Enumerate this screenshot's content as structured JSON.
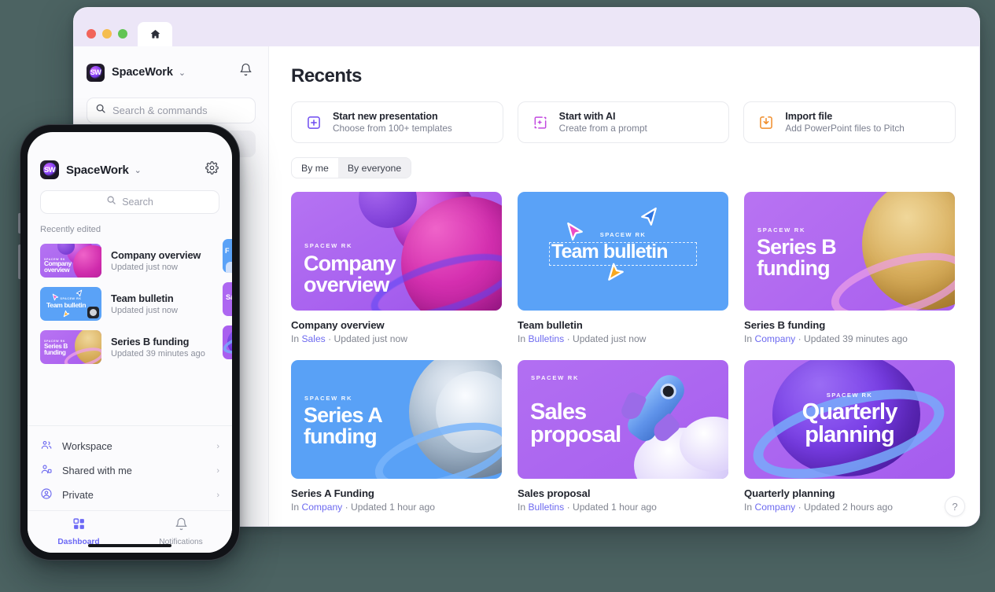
{
  "desktop": {
    "titlebar": {
      "tab_icon": "home-icon",
      "traffic_lights": [
        "close",
        "minimize",
        "maximize"
      ]
    },
    "sidebar": {
      "workspace_name": "SpaceWork",
      "workspace_logo_text": "SW",
      "chevron": "⌄",
      "notification_icon": "bell-icon",
      "search": {
        "placeholder": "Search & commands",
        "icon": "search-icon"
      }
    },
    "main": {
      "page_title": "Recents",
      "actions": [
        {
          "icon": "plus-square-icon",
          "title": "Start new presentation",
          "subtitle": "Choose from 100+ templates"
        },
        {
          "icon": "sparkle-ai-icon",
          "title": "Start with AI",
          "subtitle": "Create from a prompt"
        },
        {
          "icon": "import-download-icon",
          "title": "Import file",
          "subtitle": "Add PowerPoint files to Pitch"
        }
      ],
      "segmented": {
        "options": [
          "By me",
          "By everyone"
        ],
        "selected": "By everyone"
      },
      "cards": [
        {
          "name": "Company overview",
          "in_label": "In",
          "location": "Sales",
          "separator": "·",
          "updated": "Updated just now",
          "thumb_title": "Company\noverview",
          "brand": "SPACEW RK",
          "theme": "purple-planets"
        },
        {
          "name": "Team bulletin",
          "in_label": "In",
          "location": "Bulletins",
          "separator": "·",
          "updated": "Updated just now",
          "thumb_title": "Team bulletin",
          "brand": "SPACEW RK",
          "theme": "blue-cursors"
        },
        {
          "name": "Series B funding",
          "in_label": "In",
          "location": "Company",
          "separator": "·",
          "updated": "Updated 39 minutes ago",
          "thumb_title": "Series B\nfunding",
          "brand": "SPACEW RK",
          "theme": "purple-gold-coin"
        },
        {
          "name": "Series A Funding",
          "in_label": "In",
          "location": "Company",
          "separator": "·",
          "updated": "Updated 1 hour ago",
          "thumb_title": "Series A\nfunding",
          "brand": "SPACEW RK",
          "theme": "blue-silver-coin"
        },
        {
          "name": "Sales proposal",
          "in_label": "In",
          "location": "Bulletins",
          "separator": "·",
          "updated": "Updated 1 hour ago",
          "thumb_title": "Sales\nproposal",
          "brand": "SPACEW RK",
          "theme": "purple-rocket"
        },
        {
          "name": "Quarterly planning",
          "in_label": "In",
          "location": "Company",
          "separator": "·",
          "updated": "Updated 2 hours ago",
          "thumb_title": "Quarterly\nplanning",
          "brand": "SPACEW RK",
          "theme": "purple-ringed-planet"
        }
      ],
      "help_button": "?"
    }
  },
  "phone": {
    "workspace_name": "SpaceWork",
    "workspace_logo_text": "SW",
    "chevron": "⌄",
    "settings_icon": "gear-icon",
    "search": {
      "placeholder": "Search",
      "icon": "search-icon"
    },
    "section_label": "Recently edited",
    "rows": [
      {
        "name": "Company overview",
        "updated": "Updated just now",
        "thumb_title": "Company\noverview",
        "brand": "SPACEW RK",
        "theme": "purple-planets"
      },
      {
        "name": "Team bulletin",
        "updated": "Updated just now",
        "thumb_title": "Team bulletin",
        "brand": "SPACEW RK",
        "theme": "blue-cursors",
        "badge": "avatar-badge"
      },
      {
        "name": "Series B funding",
        "updated": "Updated 39 minutes ago",
        "thumb_title": "Series B\nfunding",
        "brand": "SPACEW RK",
        "theme": "purple-gold-coin"
      }
    ],
    "ghost_rows": [
      {
        "theme": "blue-silver-coin",
        "thumb_title": "F"
      },
      {
        "theme": "purple-rocket",
        "thumb_title": "Sa"
      },
      {
        "theme": "purple-ringed-planet",
        "thumb_title": ""
      }
    ],
    "nav": [
      {
        "icon": "people-group-icon",
        "label": "Workspace",
        "chevron": "›"
      },
      {
        "icon": "shared-people-icon",
        "label": "Shared with me",
        "chevron": "›"
      },
      {
        "icon": "person-circle-icon",
        "label": "Private",
        "chevron": "›"
      }
    ],
    "tabbar": [
      {
        "icon": "grid-squares-icon",
        "label": "Dashboard",
        "active": true
      },
      {
        "icon": "bell-icon",
        "label": "Notifications",
        "active": false
      }
    ]
  },
  "colors": {
    "background": "#4c6362",
    "window_chrome": "#ece6f7",
    "accent_purple": "#6d6af0",
    "accent_orange": "#f08c28",
    "thumb_purple": "#b06af0",
    "thumb_blue": "#57a0f5"
  }
}
